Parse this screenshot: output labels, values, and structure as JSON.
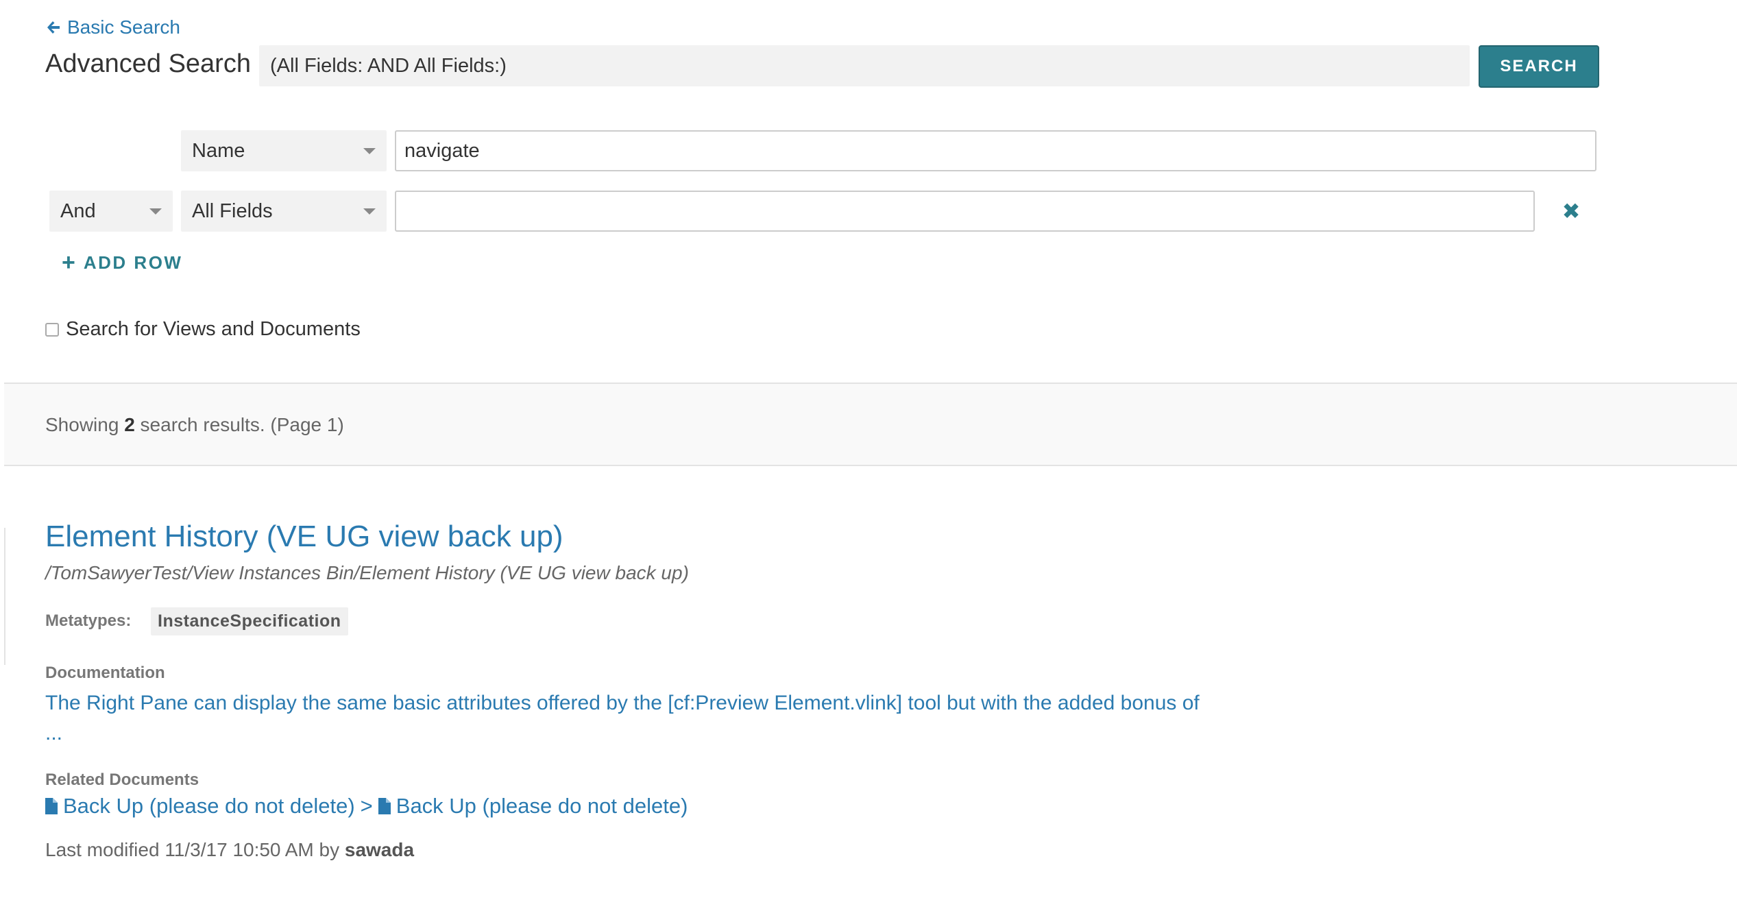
{
  "nav": {
    "back_label": "Basic Search"
  },
  "page": {
    "title": "Advanced Search"
  },
  "query": {
    "summary": "(All Fields: AND All Fields:)",
    "search_button": "SEARCH"
  },
  "rows": [
    {
      "operator": "",
      "field": "Name",
      "value": "navigate"
    },
    {
      "operator": "And",
      "field": "All Fields",
      "value": ""
    }
  ],
  "add_row_label": "ADD ROW",
  "checkbox": {
    "label": "Search for Views and Documents",
    "checked": false
  },
  "results": {
    "prefix": "Showing",
    "count": "2",
    "suffix": "search results. (Page 1)"
  },
  "result": {
    "title": "Element History (VE UG view back up)",
    "path": "/TomSawyerTest/View Instances Bin/Element History (VE UG view back up)",
    "metatypes_label": "Metatypes:",
    "metatype": "InstanceSpecification",
    "documentation_label": "Documentation",
    "documentation_line1": "The Right Pane can display the same basic attributes offered by the [cf:Preview Element.vlink] tool but with the added bonus of",
    "documentation_line2": "...",
    "related_label": "Related Documents",
    "related": [
      "Back Up (please do not delete)",
      "Back Up (please do not delete)"
    ],
    "related_separator": ">",
    "last_modified_prefix": "Last modified 11/3/17 10:50 AM by",
    "last_modified_user": "sawada"
  },
  "colors": {
    "link": "#2a7ab0",
    "accent": "#2c7f8d"
  }
}
